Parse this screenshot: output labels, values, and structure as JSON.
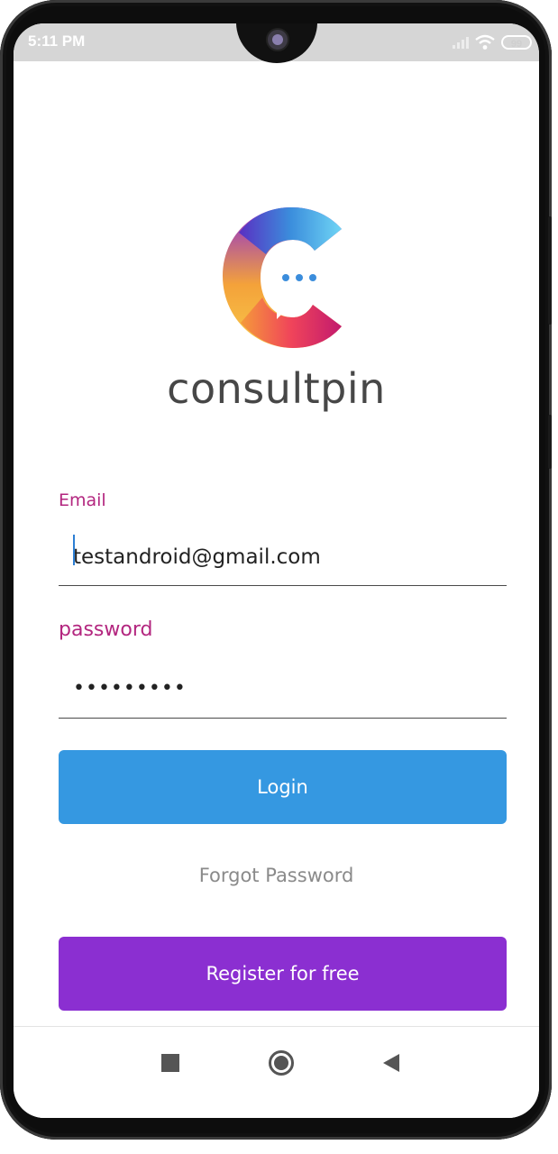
{
  "status_bar": {
    "time": "5:11 PM",
    "battery": "99"
  },
  "brand": {
    "name": "consultpin"
  },
  "login_form": {
    "email_label": "Email",
    "email_value": "testandroid@gmail.com",
    "password_label": "password",
    "password_value": "•••••••••"
  },
  "actions": {
    "login_label": "Login",
    "forgot_label": "Forgot Password",
    "register_label": "Register for free"
  },
  "nav_bar": {
    "icons": [
      "recents-square-icon",
      "home-circle-icon",
      "back-triangle-icon"
    ]
  },
  "colors": {
    "accent_label": "#b3267f",
    "login_button": "#3598e1",
    "register_button": "#8b2fd1",
    "forgot_text": "#8a8a8a"
  }
}
